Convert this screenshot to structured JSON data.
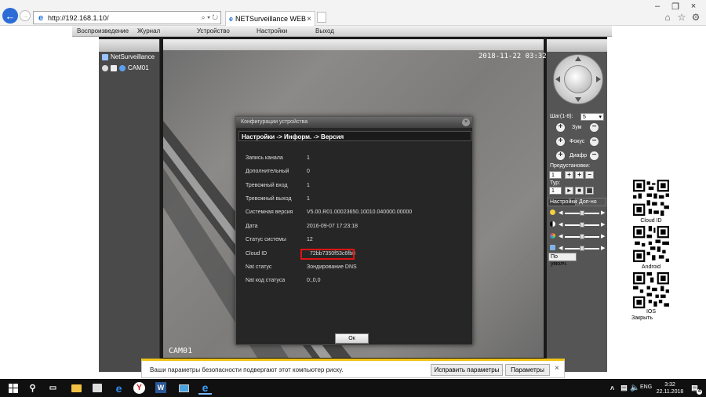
{
  "browser": {
    "address": "http://192.168.1.10/",
    "tab_title": "NETSurveillance WEB",
    "address_tools": "⌕ ▾ ↻"
  },
  "menu": {
    "items": [
      "Воспроизведение",
      "Журнал",
      "Устройство",
      "Настройки",
      "Выход"
    ]
  },
  "tree": {
    "root": "NetSurveillance",
    "camera": "CAM01"
  },
  "video": {
    "timestamp": "2018-11-22 03:32:16",
    "channel_label": "CAM01"
  },
  "dialog": {
    "title": "Конфигурации устройства",
    "path": "Настройки -> Информ. -> Версия",
    "rows": [
      {
        "label": "Запись канала",
        "value": "1"
      },
      {
        "label": "Дополнительный",
        "value": "0"
      },
      {
        "label": "Тревожный вход",
        "value": "1"
      },
      {
        "label": "Тревожный выход",
        "value": "1"
      },
      {
        "label": "Системная версия",
        "value": "V5.00.R01.00023650.10010.040000.00000"
      },
      {
        "label": "Дата",
        "value": "2016-09-07 17:23:18"
      },
      {
        "label": "Статус системы",
        "value": "12"
      },
      {
        "label": "Cloud ID",
        "value": "72bb7350f53c6fb8"
      },
      {
        "label": "Nat статус",
        "value": "Зондирование DNS"
      },
      {
        "label": "Nat код статуса",
        "value": "0:,0,0"
      }
    ],
    "ok_label": "Ок"
  },
  "ptz": {
    "step_label": "Шаг(1-8):",
    "step_value": "5",
    "zoom_label": "Зум",
    "focus_label": "Фокус",
    "iris_label": "Диафр",
    "preset_label": "Предустановки:",
    "preset_value": "1",
    "tour_label": "Тур:",
    "tour_value": "1",
    "tab_settings": "Настройки",
    "tab_extra": "Доп-но",
    "default_label": "По умолч.",
    "sliders": [
      {
        "name": "brightness",
        "level": 0.5
      },
      {
        "name": "contrast",
        "level": 0.5
      },
      {
        "name": "saturation",
        "level": 0.5
      },
      {
        "name": "hue",
        "level": 0.5
      }
    ]
  },
  "qr": {
    "label_cloud": "Cloud ID",
    "label_android": "Android",
    "label_ios": "IOS",
    "close_label": "Закрыть"
  },
  "security_bar": {
    "message": "Ваши параметры безопасности подвергают этот компьютер риску.",
    "fix_label": "Исправить параметры",
    "settings_label": "Параметры"
  },
  "taskbar": {
    "lang": "ENG",
    "time": "3:32",
    "date": "22.11.2018",
    "notif_count": "4"
  },
  "colors": {
    "highlight_box": "#e01414",
    "ie_blue": "#1a73d9",
    "warning_bar": "#f0c419"
  }
}
